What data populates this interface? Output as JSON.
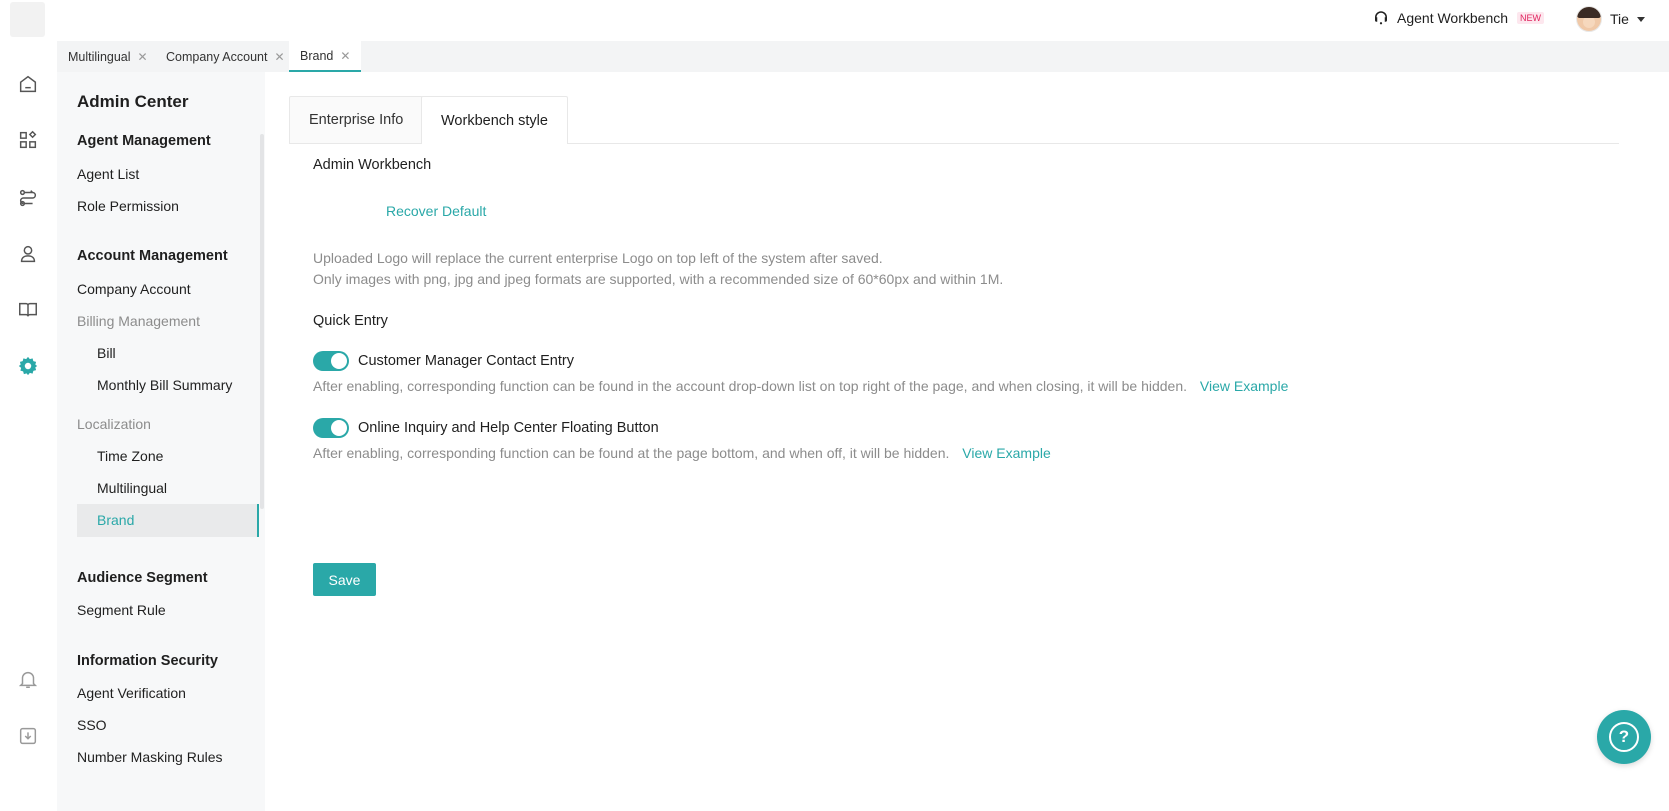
{
  "colors": {
    "accent": "#2aa8a8",
    "new_badge": "#e0245e",
    "muted_text": "#8c8c8c"
  },
  "topbar": {
    "workbench_label": "Agent Workbench",
    "new_badge": "NEW",
    "user_name": "Tie"
  },
  "tabs": [
    {
      "label": "Multilingual"
    },
    {
      "label": "Company Account"
    },
    {
      "label": "Brand"
    }
  ],
  "rail_icons": [
    "home-icon",
    "apps-icon",
    "routing-icon",
    "agent-icon",
    "book-icon",
    "settings-icon",
    "bell-icon",
    "download-icon"
  ],
  "sidebar": {
    "title": "Admin Center",
    "agent_management": {
      "label": "Agent Management",
      "items": [
        "Agent List",
        "Role Permission"
      ]
    },
    "account_management": {
      "label": "Account Management",
      "company_account": "Company Account",
      "billing_label": "Billing Management",
      "billing_items": [
        "Bill",
        "Monthly Bill Summary"
      ],
      "localization_label": "Localization",
      "localization_items": [
        "Time Zone",
        "Multilingual",
        "Brand"
      ]
    },
    "audience_segment": {
      "label": "Audience Segment",
      "items": [
        "Segment Rule"
      ]
    },
    "information_security": {
      "label": "Information Security",
      "items": [
        "Agent Verification",
        "SSO",
        "Number Masking Rules"
      ]
    }
  },
  "main": {
    "tabs": [
      "Enterprise Info",
      "Workbench style"
    ],
    "admin_workbench_label": "Admin Workbench",
    "recover_default": "Recover Default",
    "logo_hint_1": "Uploaded Logo will replace the current enterprise Logo on top left of the system after saved.",
    "logo_hint_2": "Only images with png, jpg and jpeg formats are supported, with a recommended size of 60*60px and within 1M.",
    "quick_entry_label": "Quick Entry",
    "entries": [
      {
        "label": "Customer Manager Contact Entry",
        "enabled": true,
        "hint": "After enabling, corresponding function can be found in the account drop-down list on top right of the page, and when closing, it will be hidden.",
        "link": "View Example"
      },
      {
        "label": "Online Inquiry and Help Center Floating Button",
        "enabled": true,
        "hint": "After enabling, corresponding function can be found at the page bottom, and when off, it will be hidden.",
        "link": "View Example"
      }
    ],
    "save_label": "Save",
    "help_fab": "?"
  }
}
